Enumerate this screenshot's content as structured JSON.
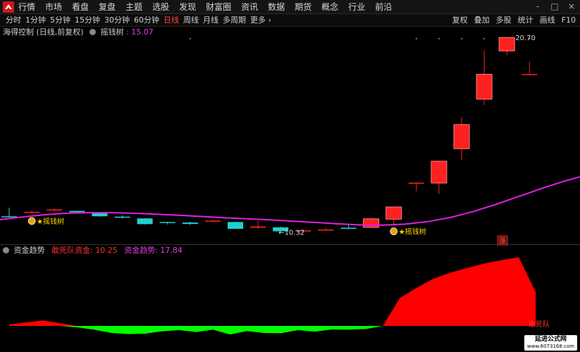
{
  "menu": [
    "行情",
    "市场",
    "看盘",
    "复盘",
    "主题",
    "选股",
    "发现",
    "财富圈",
    "资讯",
    "数据",
    "期货",
    "概念",
    "行业",
    "前沿"
  ],
  "window_controls": [
    "-",
    "□",
    "×"
  ],
  "periods": [
    {
      "label": "分时",
      "active": false
    },
    {
      "label": "1分钟",
      "active": false
    },
    {
      "label": "5分钟",
      "active": false
    },
    {
      "label": "15分钟",
      "active": false
    },
    {
      "label": "30分钟",
      "active": false
    },
    {
      "label": "60分钟",
      "active": false
    },
    {
      "label": "日线",
      "active": true
    },
    {
      "label": "周线",
      "active": false
    },
    {
      "label": "月线",
      "active": false
    },
    {
      "label": "多周期",
      "active": false
    },
    {
      "label": "更多 ›",
      "active": false
    }
  ],
  "tools": [
    "复权",
    "叠加",
    "多股",
    "统计",
    "画线",
    "F10"
  ],
  "main_legend": {
    "stock": "海得控制 (日线,前复权)",
    "indicator": "摇钱树",
    "value": ": 15.07"
  },
  "sub_legend": {
    "name": "资金趋势",
    "item1": "敢死队资金: 10.25",
    "item2": "资金趋势: 17.84"
  },
  "colors": {
    "up": "#ff2020",
    "down": "#20d0d0",
    "ma": "#e020e0",
    "signal": "#ffd700",
    "positive": "#ff0000",
    "negative": "#00ff00"
  },
  "candles": [
    {
      "o": 10.7,
      "c": 10.68,
      "h": 11.18,
      "l": 10.65
    },
    {
      "o": 10.92,
      "c": 10.95,
      "h": 11.02,
      "l": 10.83
    },
    {
      "o": 11.02,
      "c": 11.08,
      "h": 11.15,
      "l": 10.97
    },
    {
      "o": 11.0,
      "c": 10.93,
      "h": 11.0,
      "l": 10.86
    },
    {
      "o": 10.88,
      "c": 10.7,
      "h": 10.9,
      "l": 10.68
    },
    {
      "o": 10.68,
      "c": 10.62,
      "h": 10.75,
      "l": 10.57
    },
    {
      "o": 10.58,
      "c": 10.26,
      "h": 10.6,
      "l": 10.24
    },
    {
      "o": 10.38,
      "c": 10.34,
      "h": 10.4,
      "l": 10.24
    },
    {
      "o": 10.35,
      "c": 10.27,
      "h": 10.4,
      "l": 10.21
    },
    {
      "o": 10.4,
      "c": 10.46,
      "h": 10.5,
      "l": 10.38
    },
    {
      "o": 10.38,
      "c": 10.0,
      "h": 10.4,
      "l": 9.98
    },
    {
      "o": 10.06,
      "c": 10.13,
      "h": 10.43,
      "l": 9.99
    },
    {
      "o": 10.08,
      "c": 9.86,
      "h": 10.12,
      "l": 9.82
    },
    {
      "o": 9.91,
      "c": 9.91,
      "h": 9.97,
      "l": 9.86
    },
    {
      "o": 9.96,
      "c": 9.96,
      "h": 10.05,
      "l": 9.94
    },
    {
      "o": 10.06,
      "c": 10.0,
      "h": 10.26,
      "l": 9.98
    },
    {
      "o": 10.08,
      "c": 10.56,
      "h": 10.62,
      "l": 10.08
    },
    {
      "o": 10.54,
      "c": 11.22,
      "h": 11.24,
      "l": 10.25
    },
    {
      "o": 12.56,
      "c": 12.58,
      "h": 12.6,
      "l": 12.1
    },
    {
      "o": 12.56,
      "c": 13.78,
      "h": 13.82,
      "l": 11.95
    },
    {
      "o": 14.48,
      "c": 15.83,
      "h": 16.24,
      "l": 13.85
    },
    {
      "o": 17.25,
      "c": 18.64,
      "h": 19.98,
      "l": 16.92
    },
    {
      "o": 19.95,
      "c": 20.7,
      "h": 20.7,
      "l": 19.7
    },
    {
      "o": 18.65,
      "c": 18.65,
      "h": 19.35,
      "l": 18.65
    }
  ],
  "ma_line": [
    10.5,
    10.65,
    10.78,
    10.87,
    10.9,
    10.9,
    10.87,
    10.82,
    10.76,
    10.69,
    10.62,
    10.56,
    10.5,
    10.43,
    10.36,
    10.28,
    10.22,
    10.21,
    10.26,
    10.4,
    10.63,
    10.96,
    11.36,
    11.8,
    12.24,
    12.65,
    13.0,
    13.4,
    13.84
  ],
  "ma_start": -0.5,
  "price_labels": {
    "high": "20.70",
    "low": "←10.32"
  },
  "signals": [
    {
      "index": 1,
      "label": "★摇钱树"
    },
    {
      "index": 17,
      "label": "★摇钱树"
    }
  ],
  "zhang_badge": "涨",
  "fund_series": [
    0.25,
    0.62,
    0.98,
    0.47,
    -0.25,
    -0.65,
    -1.23,
    -1.43,
    -1.38,
    -0.95,
    -0.73,
    -1.08,
    -0.65,
    -1.52,
    -0.9,
    -1.25,
    -1.3,
    -0.75,
    -1.0,
    -0.62,
    -0.65,
    -0.55,
    0,
    4.95,
    6.8,
    8.42,
    9.48,
    10.32,
    11.1,
    11.68,
    12.2,
    6.0
  ],
  "fund_label": "敢死队",
  "watermark": {
    "line1": "延进公式网",
    "line2": "www.6073168.com"
  }
}
